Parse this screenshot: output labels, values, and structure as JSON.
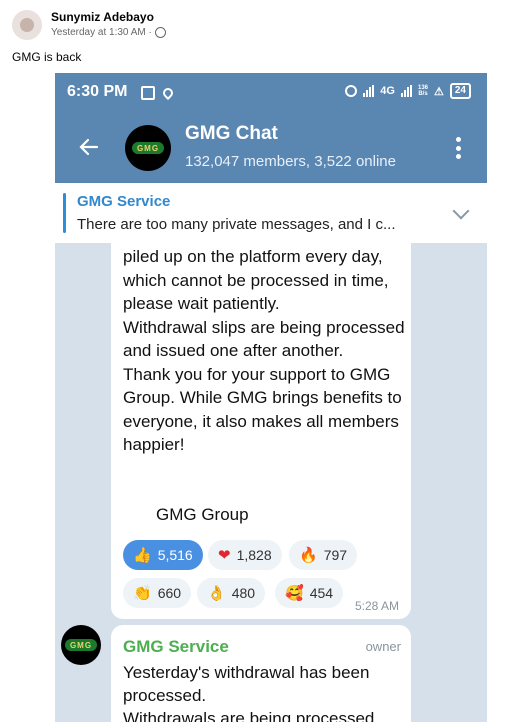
{
  "post": {
    "author": "Sunymiz Adebayo",
    "time": "Yesterday at 1:30 AM ·",
    "text": "GMG is back"
  },
  "statusbar": {
    "time": "6:30 PM",
    "network": "4G",
    "speed_top": "136",
    "speed_bottom": "B/s",
    "battery": "24"
  },
  "header": {
    "title": "GMG Chat",
    "subtitle": "132,047 members, 3,522 online",
    "logo_text": "GMG"
  },
  "pinned": {
    "title": "GMG Service",
    "text": "There are too many private messages, and I c..."
  },
  "message1": {
    "text": "piled up on the platform every day, which cannot be processed in time, please wait patiently.\nWithdrawal slips are being processed and issued one after another.\nThank you for your support to GMG Group. While GMG brings benefits to everyone, it also makes all members happier!",
    "signature": "GMG Group",
    "time": "5:28 AM",
    "reactions": [
      {
        "emoji": "👍",
        "count": "5,516"
      },
      {
        "emoji": "❤",
        "count": "1,828"
      },
      {
        "emoji": "🔥",
        "count": "797"
      },
      {
        "emoji": "👏",
        "count": "660"
      },
      {
        "emoji": "👌",
        "count": "480"
      },
      {
        "emoji": "🥰",
        "count": "454"
      }
    ]
  },
  "message2": {
    "sender": "GMG Service",
    "badge": "owner",
    "text": "Yesterday's withdrawal has been processed.\nWithdrawals are being processed"
  },
  "colors": {
    "telegram_blue": "#5a86b2",
    "link_blue": "#3388cc",
    "service_green": "#4caf50"
  }
}
